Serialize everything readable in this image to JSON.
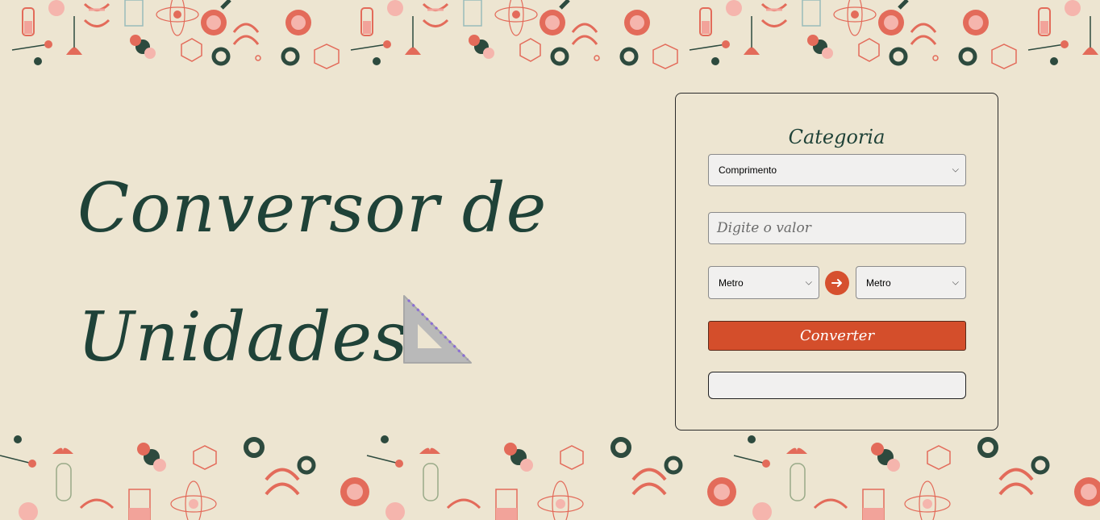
{
  "hero": {
    "title_line1": "Conversor de",
    "title_line2": "Unidades",
    "icon": "triangular-ruler-icon"
  },
  "form": {
    "category_label": "Categoria",
    "category_selected": "Comprimento",
    "value_placeholder": "Digite o valor",
    "from_unit": "Metro",
    "to_unit": "Metro",
    "arrow_icon": "arrow-right-icon",
    "convert_label": "Converter",
    "result": ""
  },
  "colors": {
    "background": "#ede5d1",
    "title": "#1f4238",
    "accent": "#d44e2b"
  }
}
